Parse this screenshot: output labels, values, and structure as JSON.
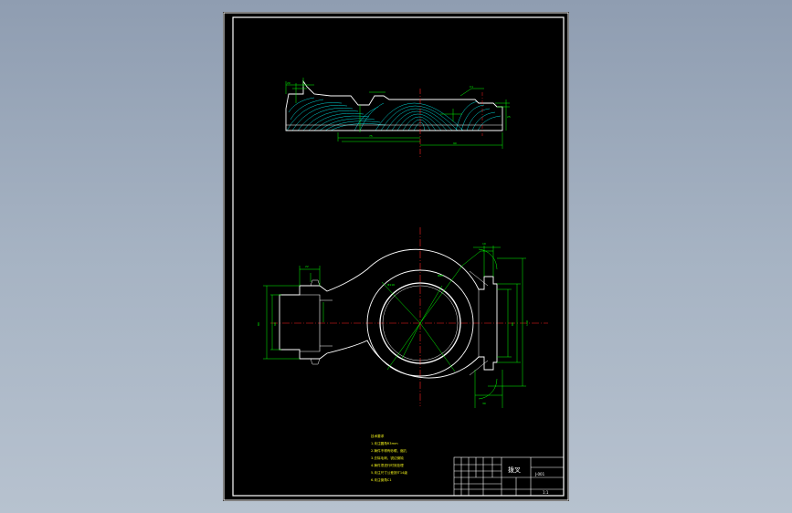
{
  "drawing": {
    "notes_heading": "技术要求",
    "notes": [
      "1.未注圆角R3mm",
      "2.铸件不得有砂眼、缩孔",
      "3.去除毛刺，锐边倒钝",
      "4.铸件须进行时效处理",
      "5.未注尺寸公差按IT14级",
      "6.未注倒角C1"
    ],
    "title_block": {
      "part_name": "拨叉",
      "drawing_no": "J-001",
      "scale": "1:1"
    }
  },
  "colors": {
    "background": "#a3b0c0",
    "sheet": "#000000",
    "outline": "#ffffff",
    "dimension": "#00ff00",
    "centerline": "#ff2020",
    "hatch": "#00e0e0",
    "notes": "#f2f21a"
  }
}
